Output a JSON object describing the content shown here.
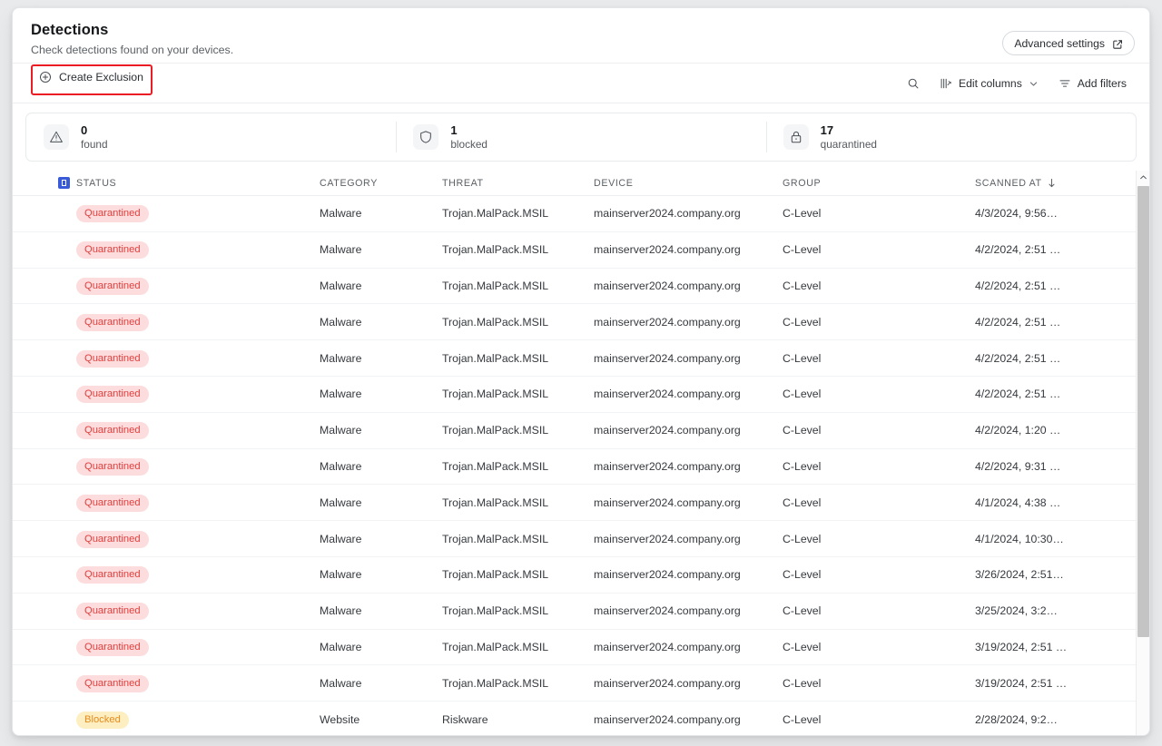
{
  "header": {
    "title": "Detections",
    "subtitle": "Check detections found on your devices.",
    "advanced_settings_label": "Advanced settings",
    "external_link_icon": "external-link-icon"
  },
  "toolbar": {
    "create_exclusion_label": "Create Exclusion",
    "plus_icon": "plus-circle-icon",
    "highlight_color": "#ec1c24",
    "search_icon": "search-icon",
    "edit_columns_label": "Edit columns",
    "edit_columns_icon": "columns-icon",
    "chevron_icon": "chevron-down-icon",
    "add_filters_label": "Add filters",
    "filter_icon": "filter-icon"
  },
  "stats": [
    {
      "icon": "warning-triangle-icon",
      "value": "0",
      "label": "found"
    },
    {
      "icon": "shield-icon",
      "value": "1",
      "label": "blocked"
    },
    {
      "icon": "lock-icon",
      "value": "17",
      "label": "quarantined"
    }
  ],
  "table": {
    "select_all_state": "indeterminate",
    "select_all_color": "#3a5bd9",
    "columns": [
      "STATUS",
      "CATEGORY",
      "THREAT",
      "DEVICE",
      "GROUP",
      "SCANNED AT"
    ],
    "sort_column": "SCANNED AT",
    "sort_icon": "arrow-down-icon",
    "rows": [
      {
        "status": "Quarantined",
        "status_type": "quarantined",
        "category": "Malware",
        "threat": "Trojan.MalPack.MSIL",
        "device": "mainserver2024.company.org",
        "group": "C-Level",
        "scanned_at": "4/3/2024, 9:56…"
      },
      {
        "status": "Quarantined",
        "status_type": "quarantined",
        "category": "Malware",
        "threat": "Trojan.MalPack.MSIL",
        "device": "mainserver2024.company.org",
        "group": "C-Level",
        "scanned_at": "4/2/2024, 2:51 …"
      },
      {
        "status": "Quarantined",
        "status_type": "quarantined",
        "category": "Malware",
        "threat": "Trojan.MalPack.MSIL",
        "device": "mainserver2024.company.org",
        "group": "C-Level",
        "scanned_at": "4/2/2024, 2:51 …"
      },
      {
        "status": "Quarantined",
        "status_type": "quarantined",
        "category": "Malware",
        "threat": "Trojan.MalPack.MSIL",
        "device": "mainserver2024.company.org",
        "group": "C-Level",
        "scanned_at": "4/2/2024, 2:51 …"
      },
      {
        "status": "Quarantined",
        "status_type": "quarantined",
        "category": "Malware",
        "threat": "Trojan.MalPack.MSIL",
        "device": "mainserver2024.company.org",
        "group": "C-Level",
        "scanned_at": "4/2/2024, 2:51 …"
      },
      {
        "status": "Quarantined",
        "status_type": "quarantined",
        "category": "Malware",
        "threat": "Trojan.MalPack.MSIL",
        "device": "mainserver2024.company.org",
        "group": "C-Level",
        "scanned_at": "4/2/2024, 2:51 …"
      },
      {
        "status": "Quarantined",
        "status_type": "quarantined",
        "category": "Malware",
        "threat": "Trojan.MalPack.MSIL",
        "device": "mainserver2024.company.org",
        "group": "C-Level",
        "scanned_at": "4/2/2024, 1:20 …"
      },
      {
        "status": "Quarantined",
        "status_type": "quarantined",
        "category": "Malware",
        "threat": "Trojan.MalPack.MSIL",
        "device": "mainserver2024.company.org",
        "group": "C-Level",
        "scanned_at": "4/2/2024, 9:31 …"
      },
      {
        "status": "Quarantined",
        "status_type": "quarantined",
        "category": "Malware",
        "threat": "Trojan.MalPack.MSIL",
        "device": "mainserver2024.company.org",
        "group": "C-Level",
        "scanned_at": "4/1/2024, 4:38 …"
      },
      {
        "status": "Quarantined",
        "status_type": "quarantined",
        "category": "Malware",
        "threat": "Trojan.MalPack.MSIL",
        "device": "mainserver2024.company.org",
        "group": "C-Level",
        "scanned_at": "4/1/2024, 10:30…"
      },
      {
        "status": "Quarantined",
        "status_type": "quarantined",
        "category": "Malware",
        "threat": "Trojan.MalPack.MSIL",
        "device": "mainserver2024.company.org",
        "group": "C-Level",
        "scanned_at": "3/26/2024, 2:51…"
      },
      {
        "status": "Quarantined",
        "status_type": "quarantined",
        "category": "Malware",
        "threat": "Trojan.MalPack.MSIL",
        "device": "mainserver2024.company.org",
        "group": "C-Level",
        "scanned_at": "3/25/2024, 3:2…"
      },
      {
        "status": "Quarantined",
        "status_type": "quarantined",
        "category": "Malware",
        "threat": "Trojan.MalPack.MSIL",
        "device": "mainserver2024.company.org",
        "group": "C-Level",
        "scanned_at": "3/19/2024, 2:51 …"
      },
      {
        "status": "Quarantined",
        "status_type": "quarantined",
        "category": "Malware",
        "threat": "Trojan.MalPack.MSIL",
        "device": "mainserver2024.company.org",
        "group": "C-Level",
        "scanned_at": "3/19/2024, 2:51 …"
      },
      {
        "status": "Blocked",
        "status_type": "blocked",
        "category": "Website",
        "threat": "Riskware",
        "device": "mainserver2024.company.org",
        "group": "C-Level",
        "scanned_at": "2/28/2024, 9:2…"
      }
    ]
  },
  "scrollbar": {
    "up_icon": "chevron-up-icon",
    "down_icon": "chevron-down-icon"
  }
}
